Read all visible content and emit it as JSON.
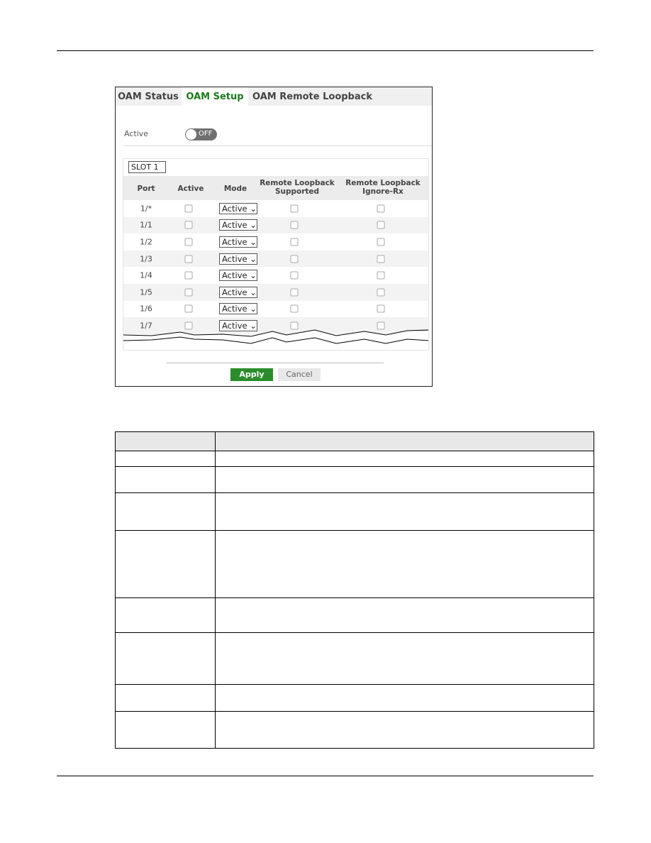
{
  "screen": {
    "tabs": [
      {
        "label": "OAM Status"
      },
      {
        "label": "OAM Setup",
        "active": true
      },
      {
        "label": "OAM Remote Loopback"
      }
    ],
    "active_label": "Active",
    "active_toggle": {
      "state": "OFF"
    },
    "slot_select": "SLOT 1",
    "columns": [
      "Port",
      "Active",
      "Mode",
      "Remote Loopback Supported",
      "Remote Loopback Ignore-Rx"
    ],
    "rows": [
      {
        "port": "1/*",
        "mode": "Active"
      },
      {
        "port": "1/1",
        "mode": "Active"
      },
      {
        "port": "1/2",
        "mode": "Active"
      },
      {
        "port": "1/3",
        "mode": "Active"
      },
      {
        "port": "1/4",
        "mode": "Active"
      },
      {
        "port": "1/5",
        "mode": "Active"
      },
      {
        "port": "1/6",
        "mode": "Active"
      },
      {
        "port": "1/7",
        "mode": "Active"
      }
    ],
    "apply_label": "Apply",
    "cancel_label": "Cancel",
    "colors": {
      "accent": "#1d7a1d",
      "apply": "#2b8c2b"
    }
  }
}
